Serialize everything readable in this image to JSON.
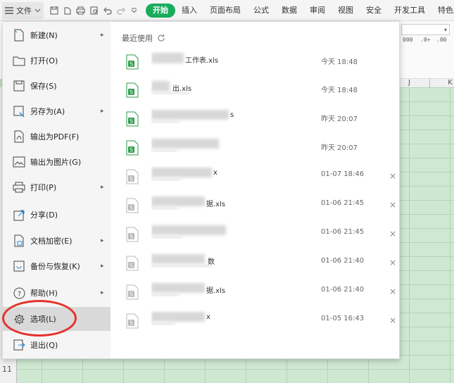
{
  "ribbon": {
    "file_label": "文件",
    "tabs": [
      {
        "label": "开始",
        "active": true
      },
      {
        "label": "插入"
      },
      {
        "label": "页面布局"
      },
      {
        "label": "公式"
      },
      {
        "label": "数据"
      },
      {
        "label": "审阅"
      },
      {
        "label": "视图"
      },
      {
        "label": "安全"
      },
      {
        "label": "开发工具"
      },
      {
        "label": "特色应"
      }
    ],
    "accent_color": "#1aad5c"
  },
  "sheet": {
    "columns": [
      "J",
      "K"
    ],
    "row_number": "11",
    "toolstrip": {
      "btn1": "000",
      "btn2": ".0+",
      "btn3": ".00"
    },
    "grid_color": "#cfe8d2"
  },
  "file_menu": {
    "items": [
      {
        "label": "新建(N)",
        "icon": "new-file-icon",
        "submenu": true
      },
      {
        "label": "打开(O)",
        "icon": "folder-open-icon",
        "submenu": false
      },
      {
        "label": "保存(S)",
        "icon": "save-icon",
        "submenu": false
      },
      {
        "label": "另存为(A)",
        "icon": "save-as-icon",
        "submenu": true
      },
      {
        "label": "输出为PDF(F)",
        "icon": "pdf-icon",
        "submenu": false
      },
      {
        "label": "输出为图片(G)",
        "icon": "image-icon",
        "submenu": false
      },
      {
        "label": "打印(P)",
        "icon": "print-icon",
        "submenu": true
      },
      {
        "label": "分享(D)",
        "icon": "share-icon",
        "submenu": false
      },
      {
        "label": "文档加密(E)",
        "icon": "encrypt-icon",
        "submenu": true
      },
      {
        "label": "备份与恢复(K)",
        "icon": "backup-icon",
        "submenu": true
      },
      {
        "label": "帮助(H)",
        "icon": "help-icon",
        "submenu": true
      },
      {
        "label": "选项(L)",
        "icon": "gear-icon",
        "submenu": false,
        "selected": true
      },
      {
        "label": "退出(Q)",
        "icon": "exit-icon",
        "submenu": false
      }
    ],
    "recent": {
      "title": "最近使用",
      "files": [
        {
          "name": "工作表.xls",
          "time": "今天 18:48",
          "closable": false,
          "icon_color": "#2e9d4a"
        },
        {
          "name": "出.xls",
          "time": "今天 18:48",
          "closable": false,
          "icon_color": "#2e9d4a"
        },
        {
          "name": "s",
          "time": "昨天 20:07",
          "closable": false,
          "icon_color": "#2e9d4a"
        },
        {
          "name": "",
          "time": "昨天 20:07",
          "closable": false,
          "icon_color": "#2e9d4a"
        },
        {
          "name": "x",
          "time": "01-07 18:46",
          "closable": true,
          "icon_color": "#b8b8b8"
        },
        {
          "name": "据.xls",
          "time": "01-06 21:45",
          "closable": true,
          "icon_color": "#b8b8b8"
        },
        {
          "name": "",
          "time": "01-06 21:45",
          "closable": true,
          "icon_color": "#b8b8b8"
        },
        {
          "name": "数",
          "time": "01-06 21:40",
          "closable": true,
          "icon_color": "#b8b8b8"
        },
        {
          "name": "据.xls",
          "time": "01-06 21:40",
          "closable": true,
          "icon_color": "#b8b8b8"
        },
        {
          "name": "x",
          "time": "01-05 16:43",
          "closable": true,
          "icon_color": "#b8b8b8"
        }
      ],
      "close_glyph": "×"
    }
  },
  "annotation": {
    "ring_color": "#e5322c"
  }
}
